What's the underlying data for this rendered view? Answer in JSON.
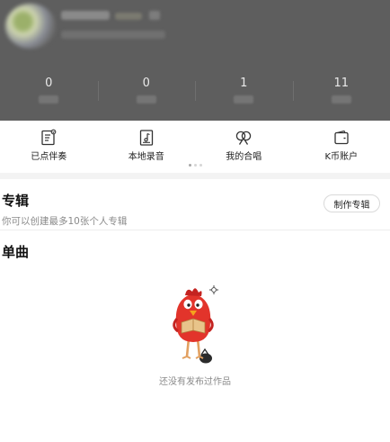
{
  "stats": [
    {
      "value": "0"
    },
    {
      "value": "0"
    },
    {
      "value": "1"
    },
    {
      "value": "11"
    }
  ],
  "quick_actions": [
    {
      "label": "已点伴奏",
      "icon": "clipboard-note-icon"
    },
    {
      "label": "本地录音",
      "icon": "music-file-icon"
    },
    {
      "label": "我的合唱",
      "icon": "duet-icon"
    },
    {
      "label": "K币账户",
      "icon": "wallet-icon"
    }
  ],
  "carousel": {
    "page_count": 3,
    "active_index": 0
  },
  "album": {
    "title": "专辑",
    "create_button": "制作专辑",
    "description": "你可以创建最多10张个人专辑"
  },
  "singles": {
    "title": "单曲",
    "empty_text": "还没有发布过作品",
    "illustration": "red-bird-mascot"
  },
  "colors": {
    "header_overlay": "#5e5e5e",
    "mascot_red": "#e2342b",
    "mascot_beak": "#f5a21d",
    "mascot_belly": "#e8c48a",
    "section_separator": "#f3f3f3"
  }
}
